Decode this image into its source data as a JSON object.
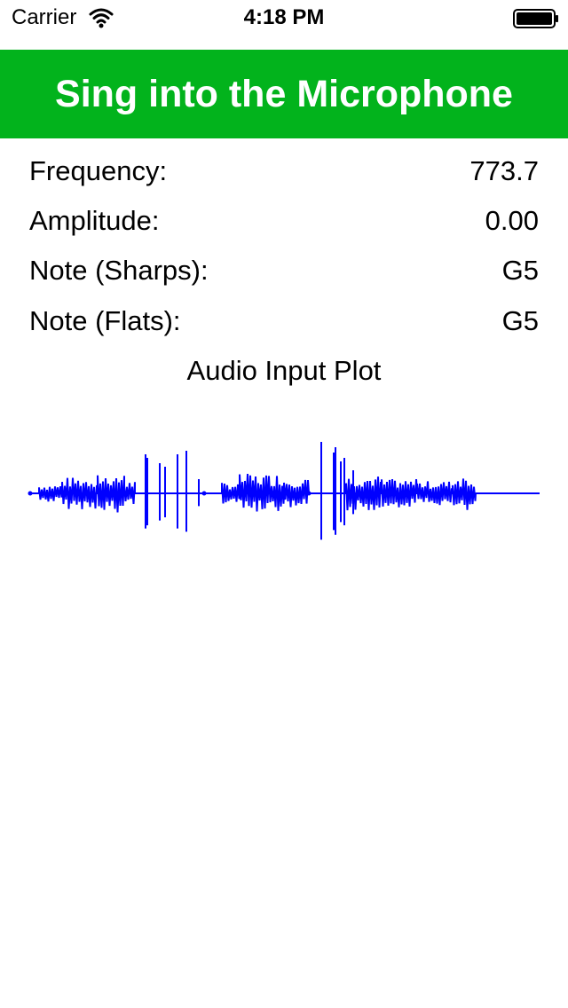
{
  "status_bar": {
    "carrier": "Carrier",
    "time": "4:18 PM",
    "icons": [
      "wifi-icon",
      "battery-icon"
    ]
  },
  "header": {
    "title": "Sing into the Microphone",
    "background_color": "#02b31c",
    "text_color": "#ffffff"
  },
  "readouts": {
    "frequency": {
      "label": "Frequency:",
      "value": "773.7"
    },
    "amplitude": {
      "label": "Amplitude:",
      "value": "0.00"
    },
    "note_sharps": {
      "label": "Note (Sharps):",
      "value": "G5"
    },
    "note_flats": {
      "label": "Note (Flats):",
      "value": "G5"
    }
  },
  "plot": {
    "title": "Audio Input Plot",
    "waveform_color": "#0000ff"
  }
}
